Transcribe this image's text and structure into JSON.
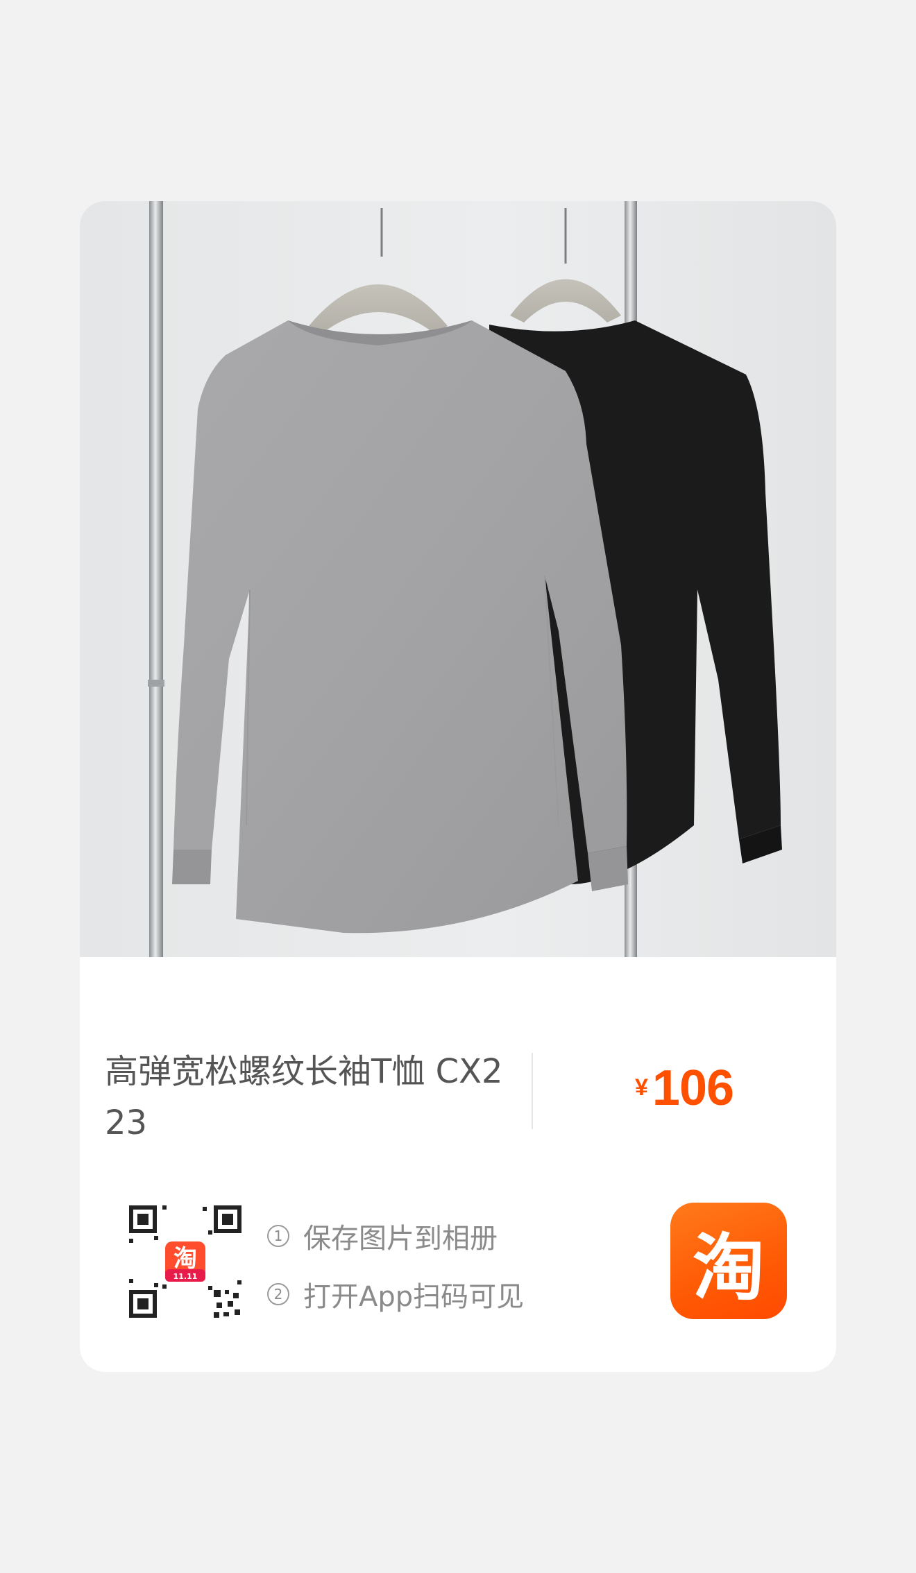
{
  "product": {
    "title": "高弹宽松螺纹长袖T恤 CX223",
    "currency": "¥",
    "price": "106"
  },
  "share": {
    "steps": [
      {
        "num": "1",
        "text": "保存图片到相册"
      },
      {
        "num": "2",
        "text": "打开App扫码可见"
      }
    ],
    "qr_badge_text": "淘",
    "qr_badge_caption": "11.11",
    "app_logo_glyph": "淘"
  },
  "colors": {
    "price": "#ff5000",
    "brand": "#ff5a05"
  },
  "icons": {
    "qr": "qr-code-icon",
    "app": "taobao-logo-icon"
  }
}
